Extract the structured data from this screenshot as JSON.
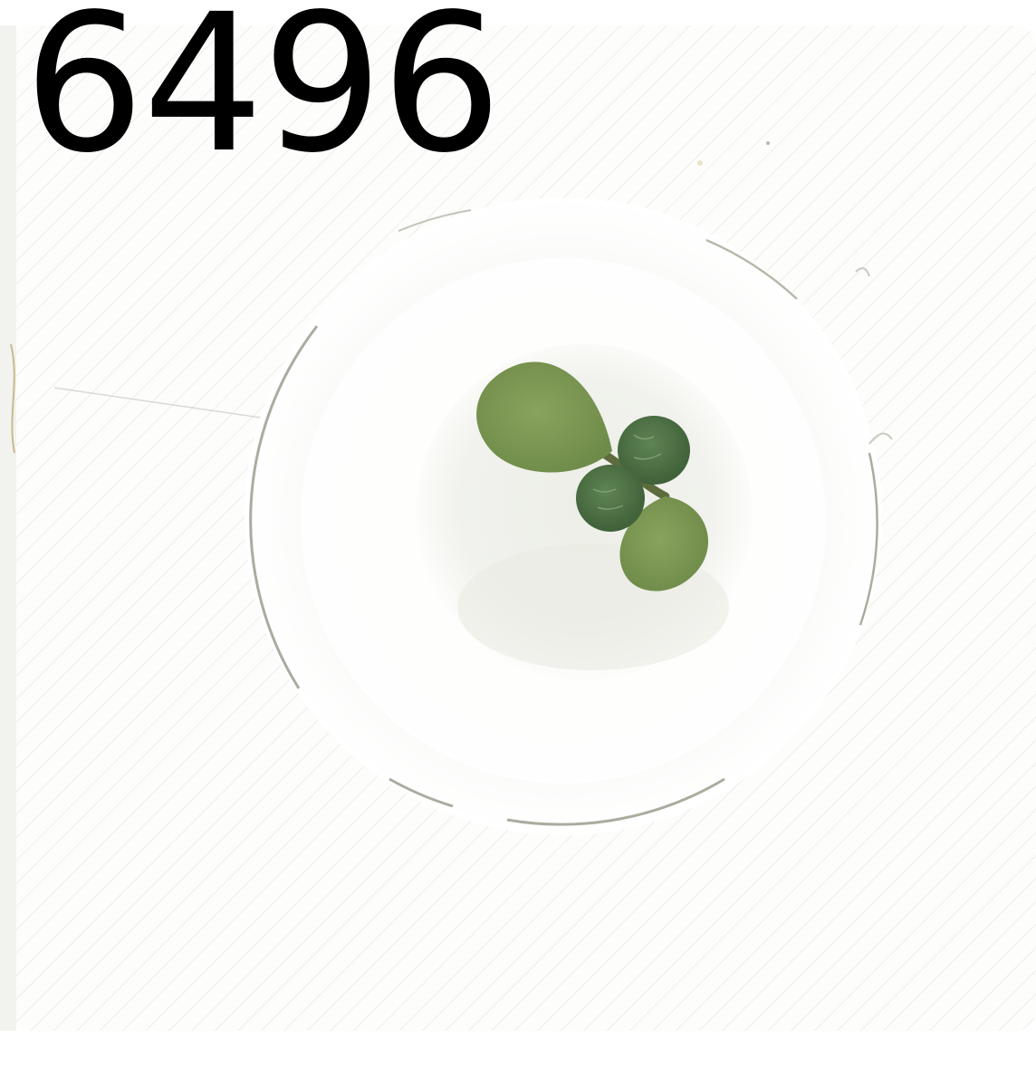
{
  "label": {
    "text": "6496"
  },
  "colors": {
    "tray_surface": "#fbfcf9",
    "stripe": "#d9ddd2",
    "well_shadow": "#e6e9e1",
    "well_edge": "#b9bcae",
    "soil": "#eef0ea",
    "cotyledon": "#7d9a52",
    "true_leaf": "#4d6f45",
    "stem": "#5d6b3d"
  },
  "objects": [
    "tray-cell",
    "pot-well",
    "seedling"
  ]
}
